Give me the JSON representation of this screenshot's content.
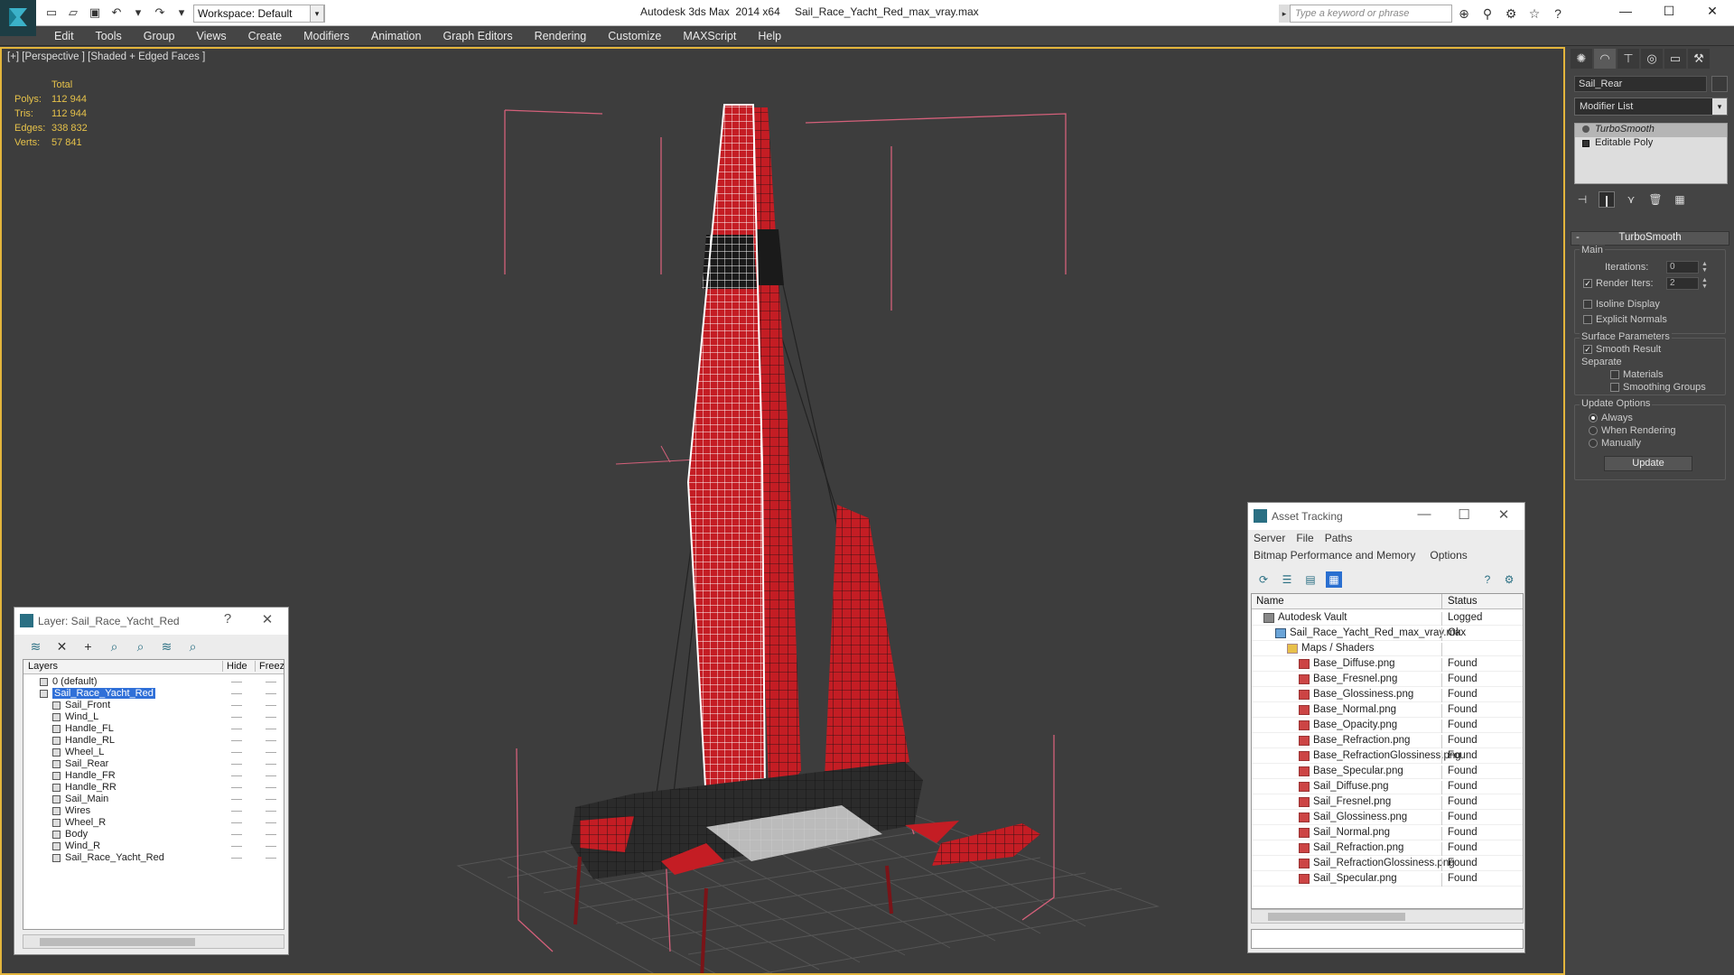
{
  "app": {
    "workspace": "Workspace: Default",
    "title": "Autodesk 3ds Max  2014 x64",
    "file": "Sail_Race_Yacht_Red_max_vray.max",
    "search_placeholder": "Type a keyword or phrase"
  },
  "menu": [
    "Edit",
    "Tools",
    "Group",
    "Views",
    "Create",
    "Modifiers",
    "Animation",
    "Graph Editors",
    "Rendering",
    "Customize",
    "MAXScript",
    "Help"
  ],
  "viewport": {
    "label": "[+] [Perspective ] [Shaded + Edged Faces ]",
    "stats": {
      "header": "Total",
      "rows": [
        {
          "k": "Polys:",
          "v": "112 944"
        },
        {
          "k": "Tris:",
          "v": "112 944"
        },
        {
          "k": "Edges:",
          "v": "338 832"
        },
        {
          "k": "Verts:",
          "v": "57 841"
        }
      ]
    },
    "colors": {
      "hull": "#c41d24",
      "wire": "#1a1a1a",
      "bbox": "#d4607a"
    }
  },
  "command_panel": {
    "object_name": "Sail_Rear",
    "modifier_list": "Modifier List",
    "stack": [
      "TurboSmooth",
      "Editable Poly"
    ],
    "turbosmooth": {
      "title": "TurboSmooth",
      "main_label": "Main",
      "iterations_label": "Iterations:",
      "iterations": "0",
      "render_iters_label": "Render Iters:",
      "render_iters": "2",
      "isoline": "Isoline Display",
      "explicit_normals": "Explicit Normals",
      "surface_params": "Surface Parameters",
      "smooth_result": "Smooth Result",
      "separate": "Separate",
      "materials": "Materials",
      "smoothing_groups": "Smoothing Groups",
      "update_options": "Update Options",
      "always": "Always",
      "when_rendering": "When Rendering",
      "manually": "Manually",
      "update": "Update"
    }
  },
  "layer_dialog": {
    "title": "Layer: Sail_Race_Yacht_Red",
    "help": "?",
    "close": "✕",
    "col_layers": "Layers",
    "col_hide": "Hide",
    "col_freeze": "Freeze",
    "rows": [
      {
        "name": "0 (default)",
        "indent": 0,
        "kind": "layer"
      },
      {
        "name": "Sail_Race_Yacht_Red",
        "indent": 0,
        "kind": "layer",
        "selected": true
      },
      {
        "name": "Sail_Front",
        "indent": 1,
        "kind": "obj"
      },
      {
        "name": "Wind_L",
        "indent": 1,
        "kind": "obj"
      },
      {
        "name": "Handle_FL",
        "indent": 1,
        "kind": "obj"
      },
      {
        "name": "Handle_RL",
        "indent": 1,
        "kind": "obj"
      },
      {
        "name": "Wheel_L",
        "indent": 1,
        "kind": "obj"
      },
      {
        "name": "Sail_Rear",
        "indent": 1,
        "kind": "obj"
      },
      {
        "name": "Handle_FR",
        "indent": 1,
        "kind": "obj"
      },
      {
        "name": "Handle_RR",
        "indent": 1,
        "kind": "obj"
      },
      {
        "name": "Sail_Main",
        "indent": 1,
        "kind": "obj"
      },
      {
        "name": "Wires",
        "indent": 1,
        "kind": "obj"
      },
      {
        "name": "Wheel_R",
        "indent": 1,
        "kind": "obj"
      },
      {
        "name": "Body",
        "indent": 1,
        "kind": "obj"
      },
      {
        "name": "Wind_R",
        "indent": 1,
        "kind": "obj"
      },
      {
        "name": "Sail_Race_Yacht_Red",
        "indent": 1,
        "kind": "obj"
      }
    ]
  },
  "asset_dialog": {
    "title": "Asset Tracking",
    "menu1": [
      "Server",
      "File",
      "Paths"
    ],
    "menu2": [
      "Bitmap Performance and Memory",
      "Options"
    ],
    "col_name": "Name",
    "col_status": "Status",
    "rows": [
      {
        "name": "Autodesk Vault",
        "status": "Logged",
        "indent": 1,
        "kind": "vault"
      },
      {
        "name": "Sail_Race_Yacht_Red_max_vray.max",
        "status": "Ok",
        "indent": 2,
        "kind": "file"
      },
      {
        "name": "Maps / Shaders",
        "status": "",
        "indent": 3,
        "kind": "fold"
      },
      {
        "name": "Base_Diffuse.png",
        "status": "Found",
        "indent": 4,
        "kind": "png"
      },
      {
        "name": "Base_Fresnel.png",
        "status": "Found",
        "indent": 4,
        "kind": "png"
      },
      {
        "name": "Base_Glossiness.png",
        "status": "Found",
        "indent": 4,
        "kind": "png"
      },
      {
        "name": "Base_Normal.png",
        "status": "Found",
        "indent": 4,
        "kind": "png"
      },
      {
        "name": "Base_Opacity.png",
        "status": "Found",
        "indent": 4,
        "kind": "png"
      },
      {
        "name": "Base_Refraction.png",
        "status": "Found",
        "indent": 4,
        "kind": "png"
      },
      {
        "name": "Base_RefractionGlossiness.png",
        "status": "Found",
        "indent": 4,
        "kind": "png"
      },
      {
        "name": "Base_Specular.png",
        "status": "Found",
        "indent": 4,
        "kind": "png"
      },
      {
        "name": "Sail_Diffuse.png",
        "status": "Found",
        "indent": 4,
        "kind": "png"
      },
      {
        "name": "Sail_Fresnel.png",
        "status": "Found",
        "indent": 4,
        "kind": "png"
      },
      {
        "name": "Sail_Glossiness.png",
        "status": "Found",
        "indent": 4,
        "kind": "png"
      },
      {
        "name": "Sail_Normal.png",
        "status": "Found",
        "indent": 4,
        "kind": "png"
      },
      {
        "name": "Sail_Refraction.png",
        "status": "Found",
        "indent": 4,
        "kind": "png"
      },
      {
        "name": "Sail_RefractionGlossiness.png",
        "status": "Found",
        "indent": 4,
        "kind": "png"
      },
      {
        "name": "Sail_Specular.png",
        "status": "Found",
        "indent": 4,
        "kind": "png"
      }
    ]
  }
}
